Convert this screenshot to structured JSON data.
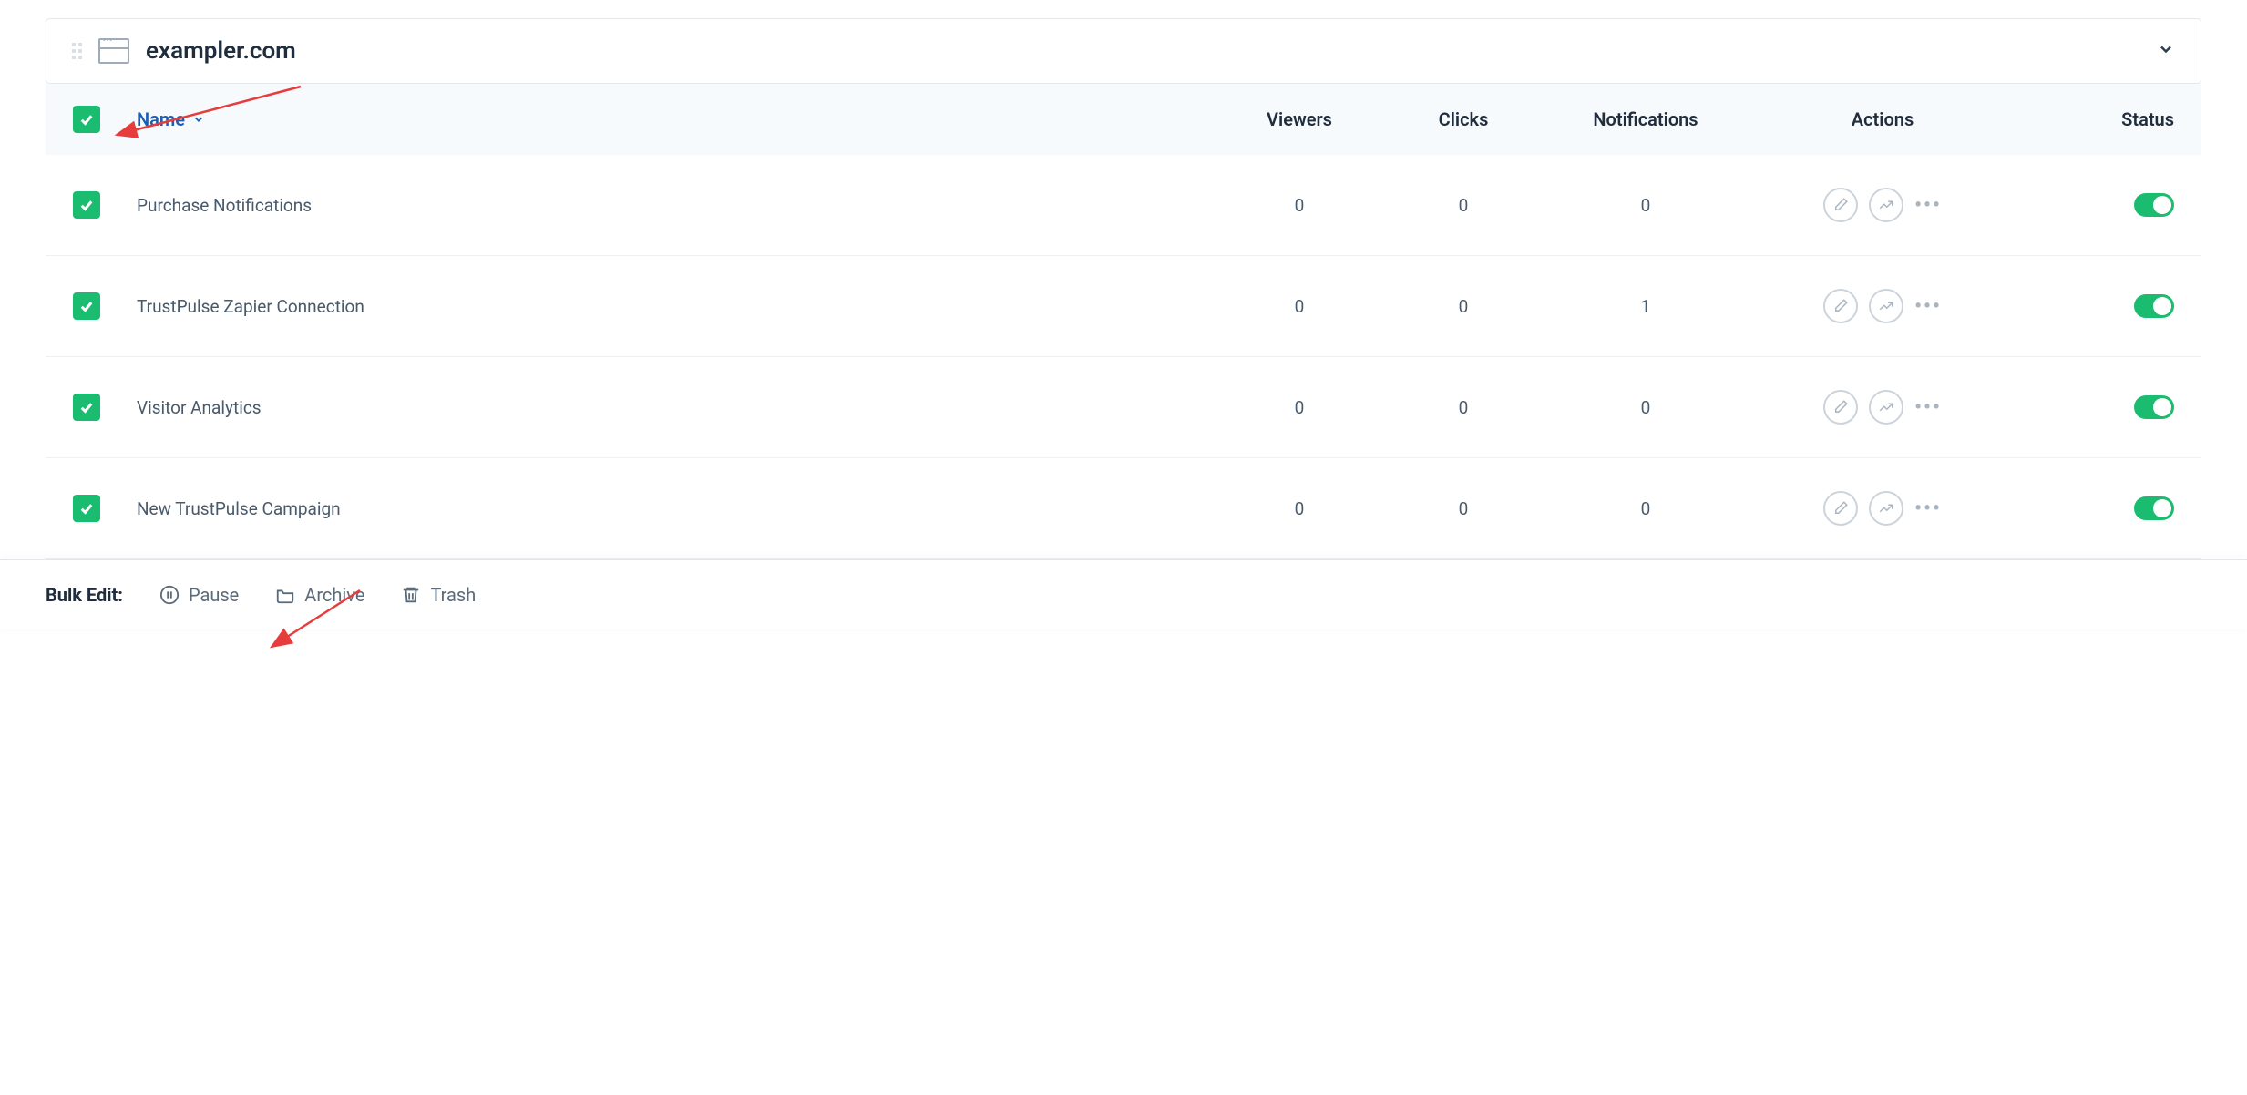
{
  "site": {
    "name": "exampler.com"
  },
  "table": {
    "headers": {
      "name": "Name",
      "viewers": "Viewers",
      "clicks": "Clicks",
      "notifications": "Notifications",
      "actions": "Actions",
      "status": "Status"
    },
    "rows": [
      {
        "checked": true,
        "name": "Purchase Notifications",
        "viewers": "0",
        "clicks": "0",
        "notifications": "0",
        "status": "on"
      },
      {
        "checked": true,
        "name": "TrustPulse Zapier Connection",
        "viewers": "0",
        "clicks": "0",
        "notifications": "1",
        "status": "on"
      },
      {
        "checked": true,
        "name": "Visitor Analytics",
        "viewers": "0",
        "clicks": "0",
        "notifications": "0",
        "status": "on"
      },
      {
        "checked": true,
        "name": "New TrustPulse Campaign",
        "viewers": "0",
        "clicks": "0",
        "notifications": "0",
        "status": "on"
      }
    ]
  },
  "bulk_edit": {
    "label": "Bulk Edit:",
    "pause": "Pause",
    "archive": "Archive",
    "trash": "Trash"
  }
}
